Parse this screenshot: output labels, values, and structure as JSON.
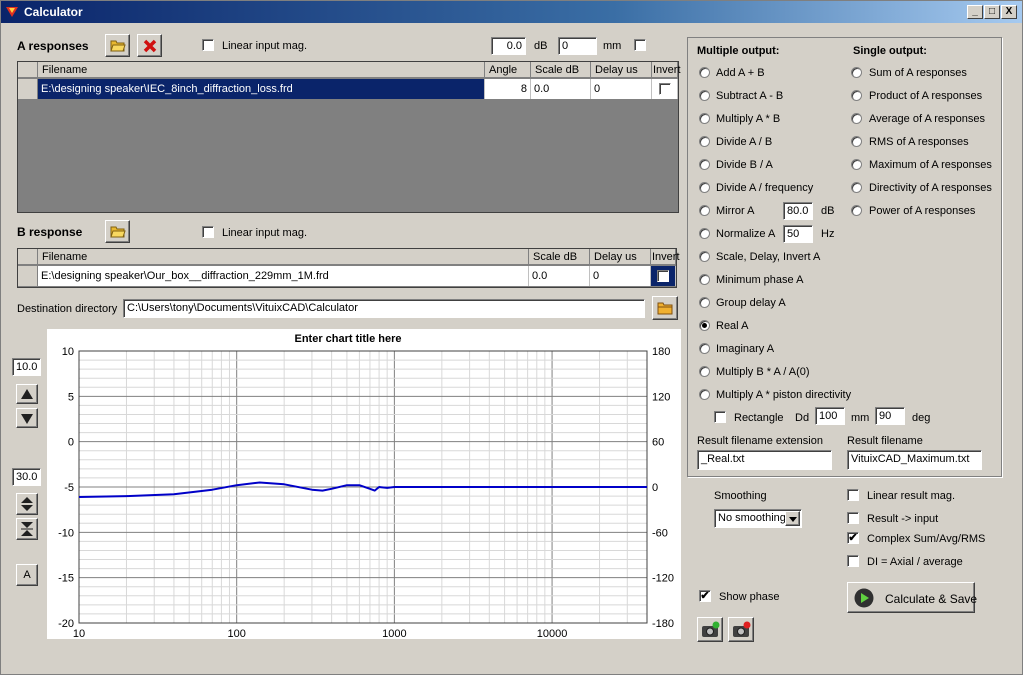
{
  "window": {
    "title": "Calculator",
    "min": "_",
    "max": "□",
    "close": "X"
  },
  "a_responses": {
    "label": "A responses",
    "linear_label": "Linear input mag.",
    "db_value": "0.0",
    "db_unit": "dB",
    "mm_value": "0",
    "mm_unit": "mm",
    "columns": [
      "Filename",
      "Angle",
      "Scale dB",
      "Delay us",
      "Invert"
    ],
    "row": {
      "filename": "E:\\designing speaker\\IEC_8inch_diffraction_loss.frd",
      "angle": "8",
      "scale": "0.0",
      "delay": "0"
    }
  },
  "b_response": {
    "label": "B response",
    "linear_label": "Linear input mag.",
    "columns": [
      "Filename",
      "Scale dB",
      "Delay us",
      "Invert"
    ],
    "row": {
      "filename": "E:\\designing speaker\\Our_box__diffraction_229mm_1M.frd",
      "scale": "0.0",
      "delay": "0"
    }
  },
  "destination": {
    "label": "Destination directory",
    "value": "C:\\Users\\tony\\Documents\\VituixCAD\\Calculator"
  },
  "left_controls": {
    "scale_top": "10.0",
    "scale_range": "30.0",
    "auto": "A"
  },
  "chart_data": {
    "type": "line",
    "title": "Enter chart title here",
    "xscale": "log",
    "xlim": [
      10,
      40000
    ],
    "ylim": [
      -20,
      10
    ],
    "y2lim": [
      -180,
      180
    ],
    "x_ticks": [
      "10",
      "100",
      "1000",
      "10000"
    ],
    "y_ticks": [
      "10",
      "5",
      "0",
      "-5",
      "-10",
      "-15",
      "-20"
    ],
    "y2_ticks": [
      "180",
      "120",
      "60",
      "0",
      "-60",
      "-120",
      "-180"
    ],
    "grid": true,
    "series": [
      {
        "color": "#0000c8",
        "x": [
          10,
          20,
          40,
          70,
          100,
          140,
          200,
          300,
          350,
          400,
          500,
          600,
          700,
          750,
          800,
          900,
          1000,
          1500,
          2000,
          5000,
          10000,
          40000
        ],
        "y": [
          -6.1,
          -6.0,
          -5.8,
          -5.3,
          -4.8,
          -4.5,
          -4.7,
          -5.3,
          -5.4,
          -5.2,
          -4.8,
          -4.8,
          -5.2,
          -5.4,
          -5.0,
          -5.1,
          -5.0,
          -5.0,
          -5.0,
          -5.0,
          -5.0,
          -5.0
        ]
      }
    ]
  },
  "multiple_output": {
    "heading": "Multiple output:",
    "options": [
      "Add A + B",
      "Subtract A - B",
      "Multiply A * B",
      "Divide A / B",
      "Divide B / A",
      "Divide A / frequency",
      "Mirror A",
      "Normalize A",
      "Scale, Delay, Invert A",
      "Minimum phase A",
      "Group delay A",
      "Real A",
      "Imaginary A",
      "Multiply B * A / A(0)",
      "Multiply A * piston directivity"
    ],
    "selected": "Real A",
    "mirror_value": "80.0",
    "mirror_unit": "dB",
    "normalize_value": "50",
    "normalize_unit": "Hz",
    "rectangle_label": "Rectangle",
    "dd_label": "Dd",
    "dd_value": "100",
    "dd_unit": "mm",
    "deg_value": "90",
    "deg_unit": "deg"
  },
  "single_output": {
    "heading": "Single output:",
    "options": [
      "Sum of A responses",
      "Product of A responses",
      "Average of A responses",
      "RMS of A responses",
      "Maximum of A responses",
      "Directivity of A responses",
      "Power of A responses"
    ]
  },
  "result": {
    "ext_label": "Result filename extension",
    "ext_value": "_Real.txt",
    "name_label": "Result filename",
    "name_value": "VituixCAD_Maximum.txt"
  },
  "smoothing": {
    "label": "Smoothing",
    "value": "No smoothing"
  },
  "options": {
    "linear_result": "Linear result mag.",
    "result_input": "Result -> input",
    "complex": "Complex Sum/Avg/RMS",
    "di": "DI = Axial / average",
    "show_phase": "Show phase"
  },
  "calculate": {
    "label": "Calculate & Save"
  }
}
